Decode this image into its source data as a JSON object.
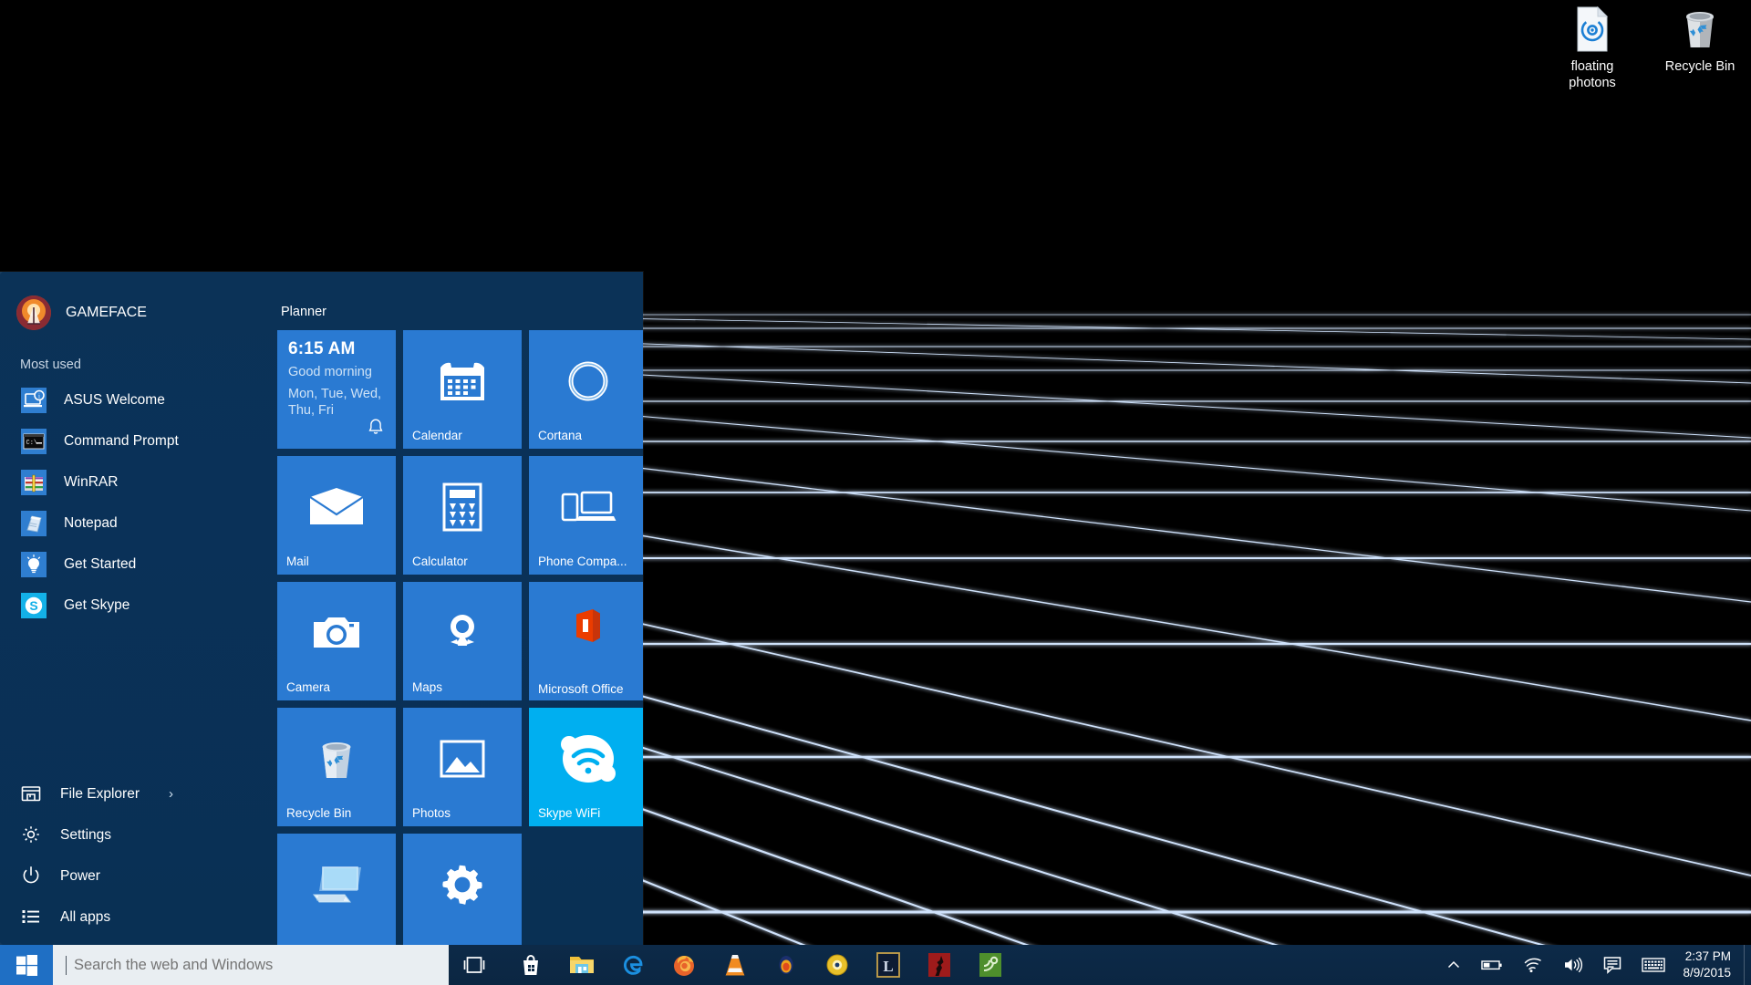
{
  "desktop": {
    "background_color": "#000000",
    "grid_color": "#c9dcf5",
    "icons": [
      {
        "label": "floating photons",
        "icon": "photon-file-icon"
      },
      {
        "label": "Recycle Bin",
        "icon": "recycle-bin-icon"
      }
    ]
  },
  "start_menu": {
    "accent_color": "#2a7ad2",
    "background_color": "#0a3158",
    "user": {
      "name": "GAMEFACE",
      "avatar": "user-avatar"
    },
    "most_used_label": "Most used",
    "most_used": [
      {
        "label": "ASUS Welcome",
        "icon": "asus-welcome-icon"
      },
      {
        "label": "Command Prompt",
        "icon": "command-prompt-icon"
      },
      {
        "label": "WinRAR",
        "icon": "winrar-icon"
      },
      {
        "label": "Notepad",
        "icon": "notepad-icon"
      },
      {
        "label": "Get Started",
        "icon": "lightbulb-icon"
      },
      {
        "label": "Get Skype",
        "icon": "skype-icon"
      }
    ],
    "bottom_items": [
      {
        "label": "File Explorer",
        "icon": "folder-icon",
        "chevron": "›"
      },
      {
        "label": "Settings",
        "icon": "gear-icon",
        "chevron": ""
      },
      {
        "label": "Power",
        "icon": "power-icon",
        "chevron": ""
      },
      {
        "label": "All apps",
        "icon": "list-icon",
        "chevron": ""
      }
    ],
    "group_title": "Planner",
    "tiles": [
      {
        "label": "",
        "icon": "planner-live-tile",
        "kind": "live",
        "time": "6:15 AM",
        "greeting": "Good morning",
        "days": "Mon, Tue, Wed, Thu, Fri"
      },
      {
        "label": "Calendar",
        "icon": "calendar-icon",
        "kind": "app"
      },
      {
        "label": "Cortana",
        "icon": "cortana-icon",
        "kind": "app"
      },
      {
        "label": "Mail",
        "icon": "mail-icon",
        "kind": "app"
      },
      {
        "label": "Calculator",
        "icon": "calculator-icon",
        "kind": "app"
      },
      {
        "label": "Phone Compa...",
        "icon": "phone-companion-icon",
        "kind": "app"
      },
      {
        "label": "Camera",
        "icon": "camera-icon",
        "kind": "app"
      },
      {
        "label": "Maps",
        "icon": "maps-icon",
        "kind": "app"
      },
      {
        "label": "Microsoft Office",
        "icon": "microsoft-office-icon",
        "kind": "app"
      },
      {
        "label": "Recycle Bin",
        "icon": "recycle-bin-icon",
        "kind": "app"
      },
      {
        "label": "Photos",
        "icon": "photos-icon",
        "kind": "app"
      },
      {
        "label": "Skype WiFi",
        "icon": "skype-wifi-icon",
        "kind": "app",
        "color": "#00aff0"
      },
      {
        "label": "",
        "icon": "remote-desktop-icon",
        "kind": "app"
      },
      {
        "label": "",
        "icon": "settings-gear-icon",
        "kind": "app"
      }
    ]
  },
  "taskbar": {
    "start_icon": "windows-logo-icon",
    "search": {
      "placeholder": "Search the web and Windows",
      "value": ""
    },
    "task_view_icon": "task-view-icon",
    "pinned": [
      {
        "name": "store-icon"
      },
      {
        "name": "file-explorer-icon"
      },
      {
        "name": "microsoft-edge-icon"
      },
      {
        "name": "firefox-icon"
      },
      {
        "name": "vlc-icon"
      },
      {
        "name": "gom-player-icon"
      },
      {
        "name": "daemon-tools-icon"
      },
      {
        "name": "league-of-legends-icon"
      },
      {
        "name": "dark-game-icon"
      },
      {
        "name": "green-app-icon"
      }
    ],
    "tray": [
      {
        "name": "show-hidden-icons-chevron"
      },
      {
        "name": "battery-icon"
      },
      {
        "name": "wifi-icon"
      },
      {
        "name": "volume-icon"
      },
      {
        "name": "action-center-icon"
      },
      {
        "name": "touch-keyboard-icon"
      }
    ],
    "clock": {
      "time": "2:37 PM",
      "date": "8/9/2015"
    }
  }
}
